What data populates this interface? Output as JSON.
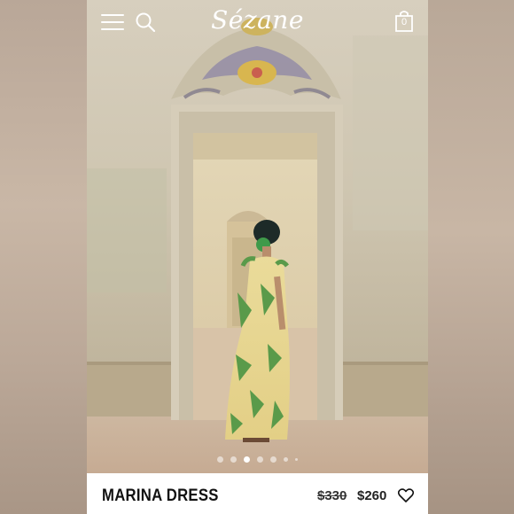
{
  "header": {
    "logo": "Sézane",
    "menu_icon": "hamburger-menu-icon",
    "search_icon": "search-icon",
    "bag_icon": "shopping-bag-icon",
    "bag_count": "0"
  },
  "carousel": {
    "slide_count": 7,
    "active_index": 2
  },
  "product": {
    "name": "MARINA DRESS",
    "original_price": "$330",
    "sale_price": "$260",
    "favorite_icon": "heart-icon"
  },
  "colors": {
    "header_text": "#ffffff",
    "product_bar_bg": "#ffffff",
    "product_text": "#111111"
  }
}
